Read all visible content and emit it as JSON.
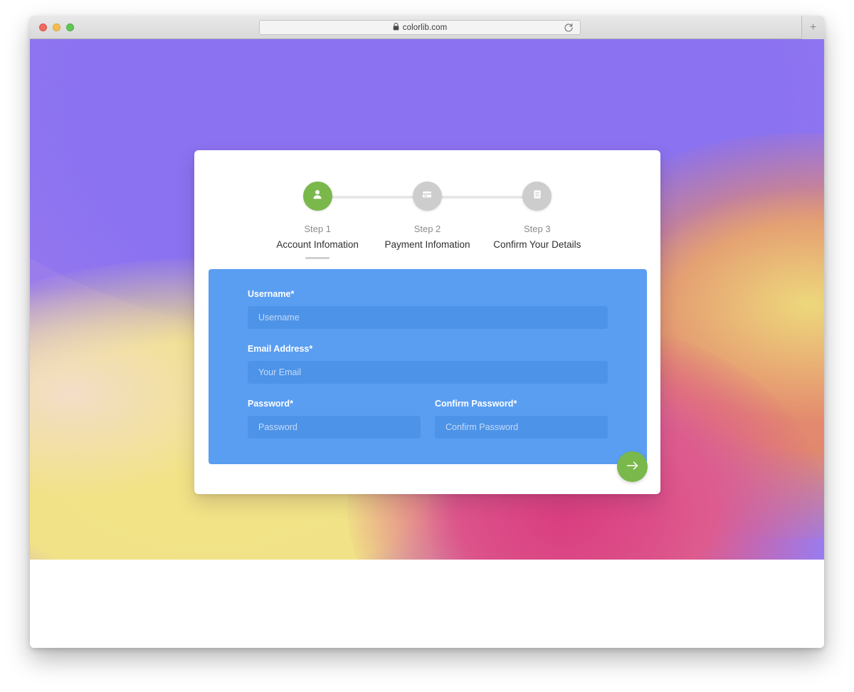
{
  "browser": {
    "url": "colorlib.com",
    "lock_icon": "lock-icon",
    "reload_icon": "reload-icon",
    "new_tab_label": "+",
    "traffic_lights": [
      "close",
      "minimize",
      "zoom"
    ]
  },
  "wizard": {
    "steps": [
      {
        "number": "Step 1",
        "title": "Account Infomation",
        "icon": "user-icon",
        "active": true
      },
      {
        "number": "Step 2",
        "title": "Payment Infomation",
        "icon": "credit-card-icon",
        "active": false
      },
      {
        "number": "Step 3",
        "title": "Confirm Your Details",
        "icon": "document-list-icon",
        "active": false
      }
    ],
    "form": {
      "username": {
        "label": "Username",
        "required_mark": "*",
        "placeholder": "Username",
        "value": ""
      },
      "email": {
        "label": "Email Address",
        "required_mark": "*",
        "placeholder": "Your Email",
        "value": ""
      },
      "password": {
        "label": "Password",
        "required_mark": "*",
        "placeholder": "Password",
        "value": ""
      },
      "confirm_password": {
        "label": "Confirm Password",
        "required_mark": "*",
        "placeholder": "Confirm Password",
        "value": ""
      }
    },
    "next_button": {
      "icon": "arrow-right-icon",
      "label": ""
    }
  },
  "colors": {
    "accent_green": "#7ab84b",
    "panel_blue": "#5a9ef2",
    "input_blue": "#4d93e8",
    "step_inactive": "#cdcdcd",
    "track": "#e7e7e7"
  }
}
